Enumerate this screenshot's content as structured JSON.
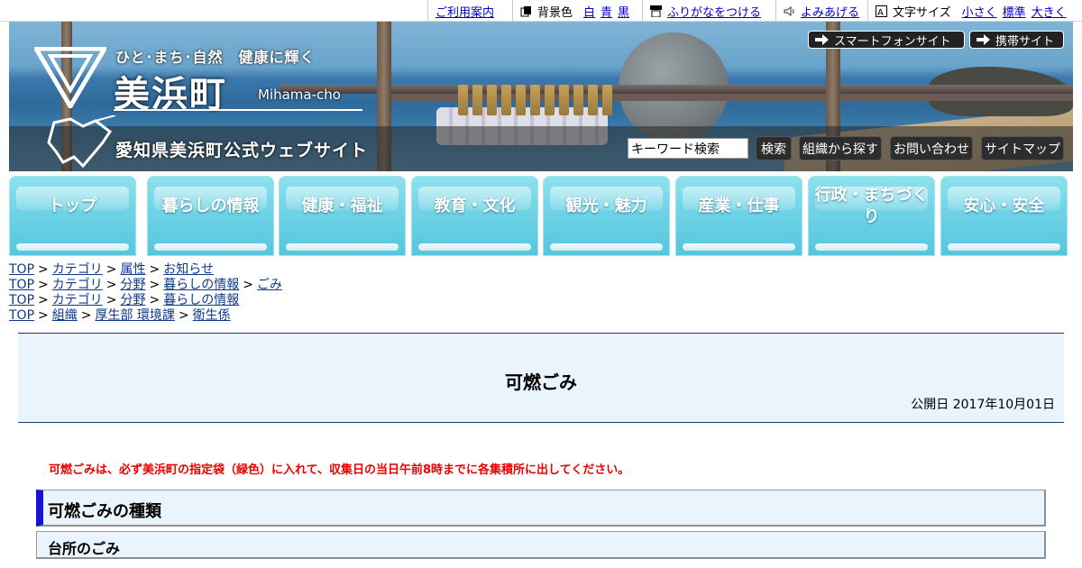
{
  "utility_bar": {
    "guide_link": "ご利用案内",
    "bg_color_label": "背景色",
    "bg_options": [
      "白",
      "青",
      "黒"
    ],
    "furigana_link": "ふりがなをつける",
    "read_aloud_link": "よみあげる",
    "font_size_label": "文字サイズ",
    "font_size_options": [
      "小さく",
      "標準",
      "大きく"
    ]
  },
  "header": {
    "tagline": "ひと･まち･自然　健康に輝く",
    "town_name": "美浜町",
    "town_name_romaji": "Mihama-cho",
    "site_name": "愛知県美浜町公式ウェブサイト",
    "smartphone_button": "スマートフォンサイト",
    "mobile_button": "携帯サイト",
    "search_value": "キーワード検索",
    "search_button": "検索",
    "org_search_button": "組織から探す",
    "contact_button": "お問い合わせ",
    "sitemap_button": "サイトマップ"
  },
  "global_nav": [
    {
      "label": "トップ"
    },
    {
      "label": "暮らしの情報"
    },
    {
      "label": "健康・福祉"
    },
    {
      "label": "教育・文化"
    },
    {
      "label": "観光・魅力"
    },
    {
      "label": "産業・仕事"
    },
    {
      "label": "行政・まちづくり"
    },
    {
      "label": "安心・安全"
    }
  ],
  "breadcrumbs": [
    [
      "TOP",
      "カテゴリ",
      "属性",
      "お知らせ"
    ],
    [
      "TOP",
      "カテゴリ",
      "分野",
      "暮らしの情報",
      "ごみ"
    ],
    [
      "TOP",
      "カテゴリ",
      "分野",
      "暮らしの情報"
    ],
    [
      "TOP",
      "組織",
      "厚生部 環境課",
      "衛生係"
    ]
  ],
  "page": {
    "title": "可燃ごみ",
    "published": "公開日 2017年10月01日",
    "notice": "可燃ごみは、必ず美浜町の指定袋（緑色）に入れて、収集日の当日午前8時までに各集積所に出してください。",
    "section_heading": "可燃ごみの種類",
    "subsection_heading": "台所のごみ"
  },
  "colors": {
    "nav_cyan": "#6fd3e6",
    "link_blue": "#0f3a8c",
    "notice_red": "#ee0000",
    "heading_accent": "#1515d2",
    "panel_bg": "#eaf4fd"
  }
}
